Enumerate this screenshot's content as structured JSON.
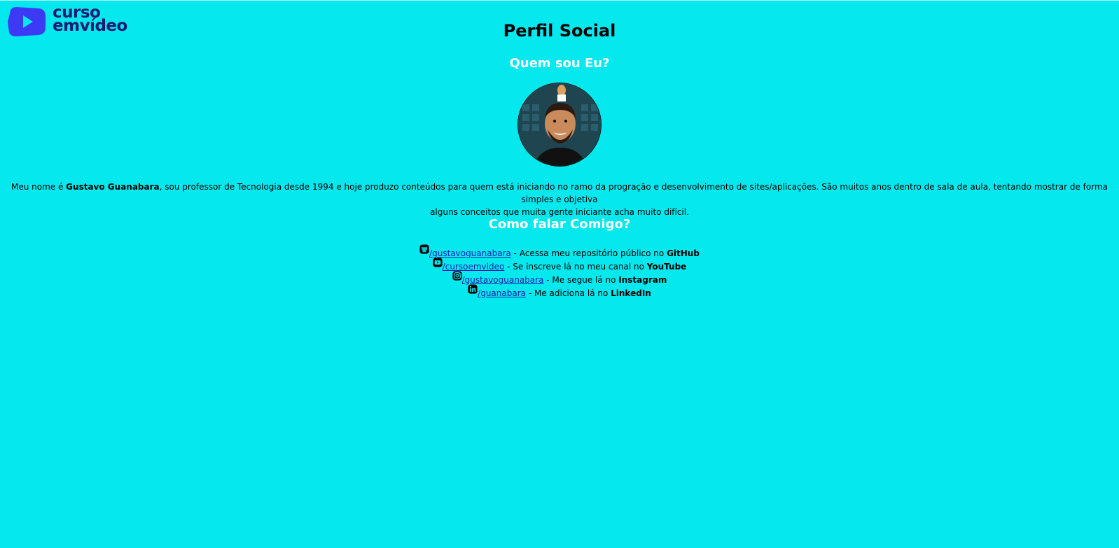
{
  "logo": {
    "line1": "curso",
    "line2": "emvídeo",
    "mark_color": "#3d3af5",
    "text_color": "#1b1a73"
  },
  "page_title": "Perfil Social",
  "about": {
    "heading": "Quem sou Eu?",
    "avatar_alt": "Gustavo Guanabara",
    "bio_prefix": "Meu nome é ",
    "bio_name": "Gustavo Guanabara",
    "bio_line1_rest": ", sou professor de Tecnologia desde 1994 e hoje produzo conteúdos para quem está iniciando no ramo da progração e desenvolvimento de sites/aplicações. São muitos anos dentro de sala de aula, tentando mostrar de forma simples e objetiva",
    "bio_line2": "alguns conceitos que muita gente iniciante acha muito difícil."
  },
  "contact": {
    "heading": "Como falar Comigo?",
    "links": [
      {
        "icon": "github-icon",
        "handle": "/gustavoguanabara",
        "text": " - Acessa meu repositório público no ",
        "platform": "GitHub"
      },
      {
        "icon": "youtube-icon",
        "handle": "/cursoemvideo",
        "text": " - Se inscreve lá no meu canal no ",
        "platform": "YouTube"
      },
      {
        "icon": "instagram-icon",
        "handle": "/gustavoguanabara",
        "text": " - Me segue lá no ",
        "platform": "Instagram"
      },
      {
        "icon": "linkedin-icon",
        "handle": "/guanabara",
        "text": " - Me adiciona lá no ",
        "platform": "LinkedIn"
      }
    ]
  },
  "colors": {
    "background": "#05e8ee",
    "heading_white": "#ffffff",
    "link": "#1f1fb0"
  }
}
